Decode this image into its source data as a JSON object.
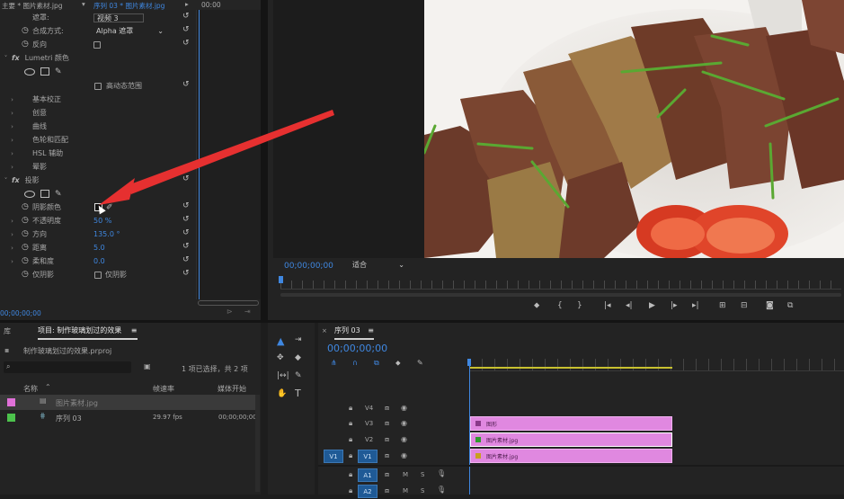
{
  "effect_controls": {
    "header_source": "主要 * 图片素材.jpg",
    "header_sequence": "序列 03 * 图片素材.jpg",
    "timecode_mini": "00:00",
    "timecode_bottom": "00;00;00;00",
    "rows": {
      "mask": {
        "label": "遮罩:",
        "value": "视频 3"
      },
      "composite": {
        "label": "合成方式:",
        "value": "Alpha 遮罩"
      },
      "invert": {
        "label": "反向"
      },
      "lumetri": {
        "fx": "fx",
        "label": "Lumetri 颜色"
      },
      "hdr": {
        "label": "高动态范围"
      },
      "basic": {
        "label": "基本校正"
      },
      "creative": {
        "label": "创意"
      },
      "curves": {
        "label": "曲线"
      },
      "wheels": {
        "label": "色轮和匹配"
      },
      "hsl": {
        "label": "HSL 辅助"
      },
      "vignette": {
        "label": "晕影"
      },
      "shadow": {
        "fx": "fx",
        "label": "投影"
      },
      "shadow_color": {
        "label": "阴影颜色"
      },
      "opacity": {
        "label": "不透明度",
        "value": "50 %"
      },
      "direction": {
        "label": "方向",
        "value": "135.0 °"
      },
      "distance": {
        "label": "距离",
        "value": "5.0"
      },
      "softness": {
        "label": "柔和度",
        "value": "0.0"
      },
      "shadow_only": {
        "label": "仅阴影",
        "value": "仅阴影"
      }
    }
  },
  "program": {
    "timecode": "00;00;00;00",
    "fit": "适合"
  },
  "project": {
    "left_tab": "库",
    "title": "项目: 制作玻璃划过的效果",
    "menu_icon": "≡",
    "file": "制作玻璃划过的效果.prproj",
    "selection": "1 项已选择，共 2 项",
    "columns": [
      "名称",
      "帧速率",
      "媒体开始"
    ],
    "items": [
      {
        "name": "图片素材.jpg",
        "fps": "",
        "start": "",
        "color": "#e070d8"
      },
      {
        "name": "序列 03",
        "fps": "29.97 fps",
        "start": "00;00;00;00",
        "color": "#4cc24c"
      }
    ]
  },
  "timeline": {
    "tab": "序列 03",
    "menu_icon": "≡",
    "timecode": "00;00;00;00",
    "tracks": [
      {
        "name": "V4"
      },
      {
        "name": "V3"
      },
      {
        "name": "V2"
      },
      {
        "name": "V1",
        "source": "V1"
      },
      {
        "name": "A1",
        "m": "M",
        "s": "S"
      },
      {
        "name": "A2",
        "m": "M",
        "s": "S"
      }
    ],
    "clips": [
      {
        "label": "图形",
        "color": "#8a3a8a"
      },
      {
        "label": "图片素材.jpg",
        "color": "#2f9a2f"
      },
      {
        "label": "图片素材.jpg",
        "color": "#c8a020"
      }
    ]
  },
  "colors": {
    "accent_blue": "#3f87e0",
    "clip_pink": "#e088e0",
    "arrow_red": "#e63030"
  }
}
